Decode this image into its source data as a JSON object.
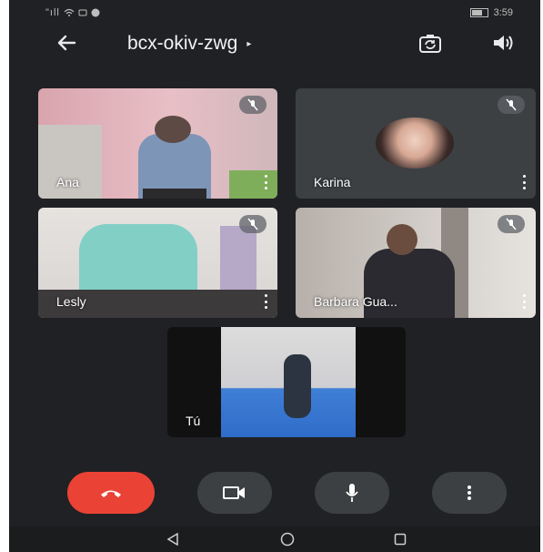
{
  "status_bar": {
    "signal_text": "\"ıll",
    "time": "3:59"
  },
  "meeting": {
    "title": "bcx-okiv-zwg",
    "title_caret": "▸"
  },
  "participants": [
    {
      "name": "Ana",
      "muted": true
    },
    {
      "name": "Karina",
      "muted": true
    },
    {
      "name": "Lesly",
      "muted": true
    },
    {
      "name": "Barbara Gua...",
      "muted": true
    }
  ],
  "self_view": {
    "name": "Tú"
  },
  "colors": {
    "background": "#202124",
    "end_call": "#ea4335",
    "control_button": "#3c4043"
  },
  "icons": [
    "arrow-left-icon",
    "camera-switch-icon",
    "speaker-icon",
    "mic-off-icon",
    "more-vert-icon",
    "end-call-icon",
    "video-camera-icon",
    "microphone-icon",
    "back-triangle-icon",
    "home-circle-icon",
    "recents-square-icon"
  ]
}
